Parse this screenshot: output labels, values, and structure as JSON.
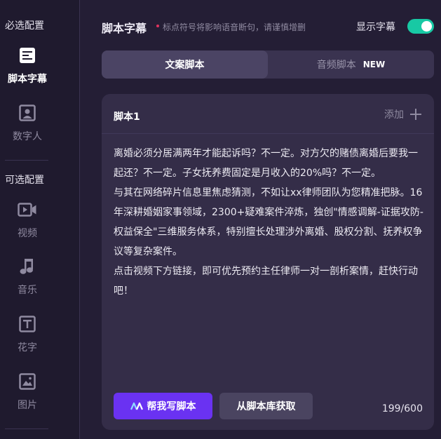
{
  "sidebar": {
    "required_section": "必选配置",
    "optional_section": "可选配置",
    "items": [
      {
        "label": "脚本字幕",
        "icon": "script-icon",
        "active": true
      },
      {
        "label": "数字人",
        "icon": "digital-human-icon",
        "active": false
      },
      {
        "label": "视频",
        "icon": "video-icon",
        "active": false
      },
      {
        "label": "音乐",
        "icon": "music-icon",
        "active": false
      },
      {
        "label": "花字",
        "icon": "text-art-icon",
        "active": false
      },
      {
        "label": "图片",
        "icon": "image-icon",
        "active": false
      }
    ]
  },
  "header": {
    "title": "脚本字幕",
    "hint": "标点符号将影响语音断句，请谨慎增删",
    "toggle_label": "显示字幕",
    "toggle_on": true
  },
  "tabs": [
    {
      "label": "文案脚本",
      "active": true,
      "badge": ""
    },
    {
      "label": "音频脚本",
      "active": false,
      "badge": "NEW"
    }
  ],
  "card": {
    "title": "脚本1",
    "add_label": "添加",
    "text": "离婚必须分居满两年才能起诉吗？不一定。对方欠的赌债离婚后要我一起还？不一定。子女抚养费固定是月收入的20%吗？不一定。\n与其在网络碎片信息里焦虑猜测，不如让xx律师团队为您精准把脉。16年深耕婚姻家事领域，2300+疑难案件淬炼，独创\"情感调解-证据攻防-权益保全\"三维服务体系，特别擅长处理涉外离婚、股权分割、抚养权争议等复杂案件。\n点击视频下方链接，即可优先预约主任律师一对一剖析案情，赶快行动吧！",
    "ai_button": "帮我写脚本",
    "library_button": "从脚本库获取",
    "counter": "199/600"
  },
  "colors": {
    "accent": "#6a32f2",
    "toggle": "#18c9a4",
    "dot": "#e0325e"
  }
}
